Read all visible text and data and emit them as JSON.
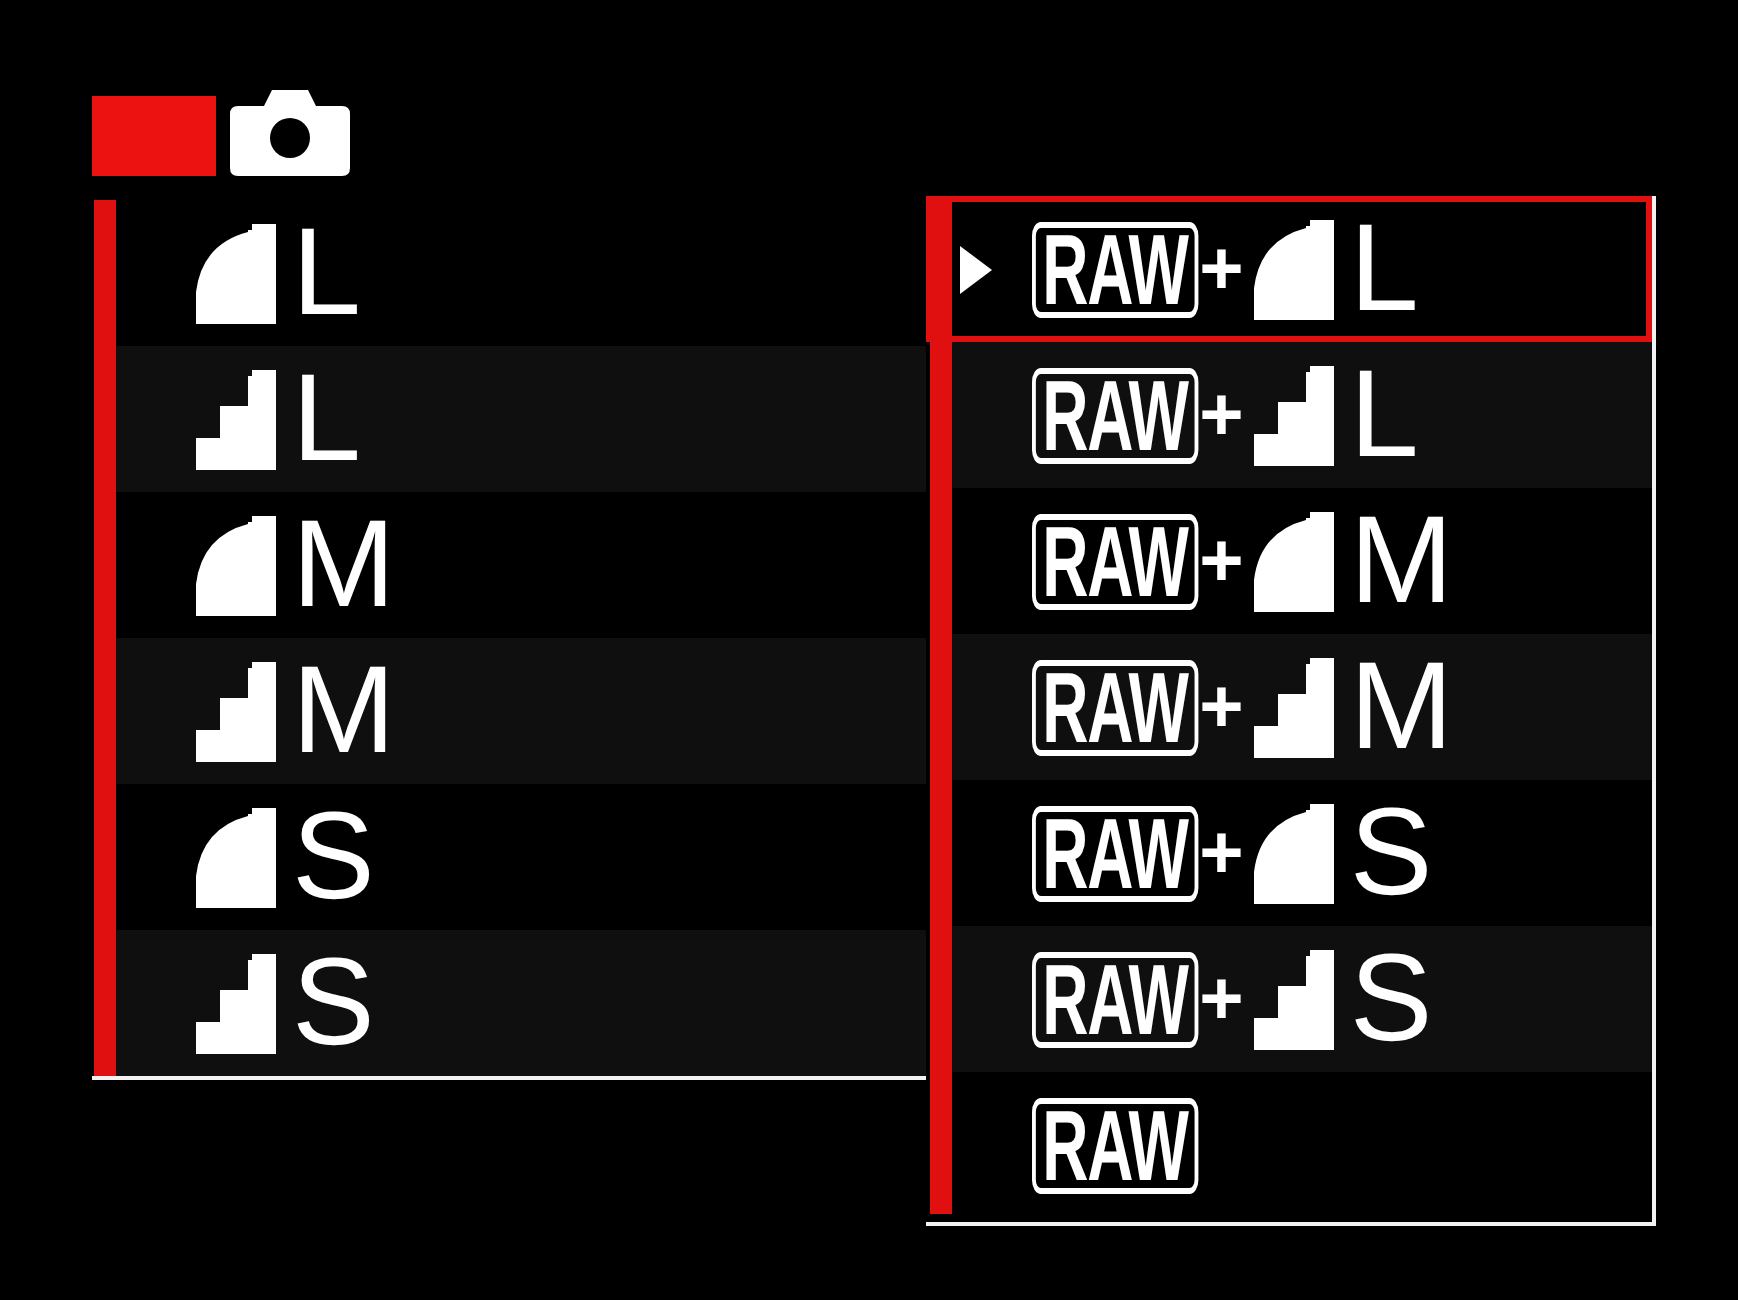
{
  "tabs": [
    {
      "kind": "blank",
      "selected": true
    },
    {
      "kind": "camera",
      "selected": false
    }
  ],
  "quality_list": {
    "items": [
      {
        "kind": "fine",
        "size": "L",
        "selected": false
      },
      {
        "kind": "normal",
        "size": "L",
        "selected": false
      },
      {
        "kind": "fine",
        "size": "M",
        "selected": false
      },
      {
        "kind": "normal",
        "size": "M",
        "selected": false
      },
      {
        "kind": "fine",
        "size": "S",
        "selected": false
      },
      {
        "kind": "normal",
        "size": "S",
        "selected": false
      }
    ]
  },
  "raw_list": {
    "items": [
      {
        "raw": "RAW",
        "plus": "+",
        "kind": "fine",
        "size": "L",
        "selected": true
      },
      {
        "raw": "RAW",
        "plus": "+",
        "kind": "normal",
        "size": "L",
        "selected": false
      },
      {
        "raw": "RAW",
        "plus": "+",
        "kind": "fine",
        "size": "M",
        "selected": false
      },
      {
        "raw": "RAW",
        "plus": "+",
        "kind": "normal",
        "size": "M",
        "selected": false
      },
      {
        "raw": "RAW",
        "plus": "+",
        "kind": "fine",
        "size": "S",
        "selected": false
      },
      {
        "raw": "RAW",
        "plus": "+",
        "kind": "normal",
        "size": "S",
        "selected": false
      },
      {
        "raw": "RAW",
        "selected": false
      }
    ]
  }
}
